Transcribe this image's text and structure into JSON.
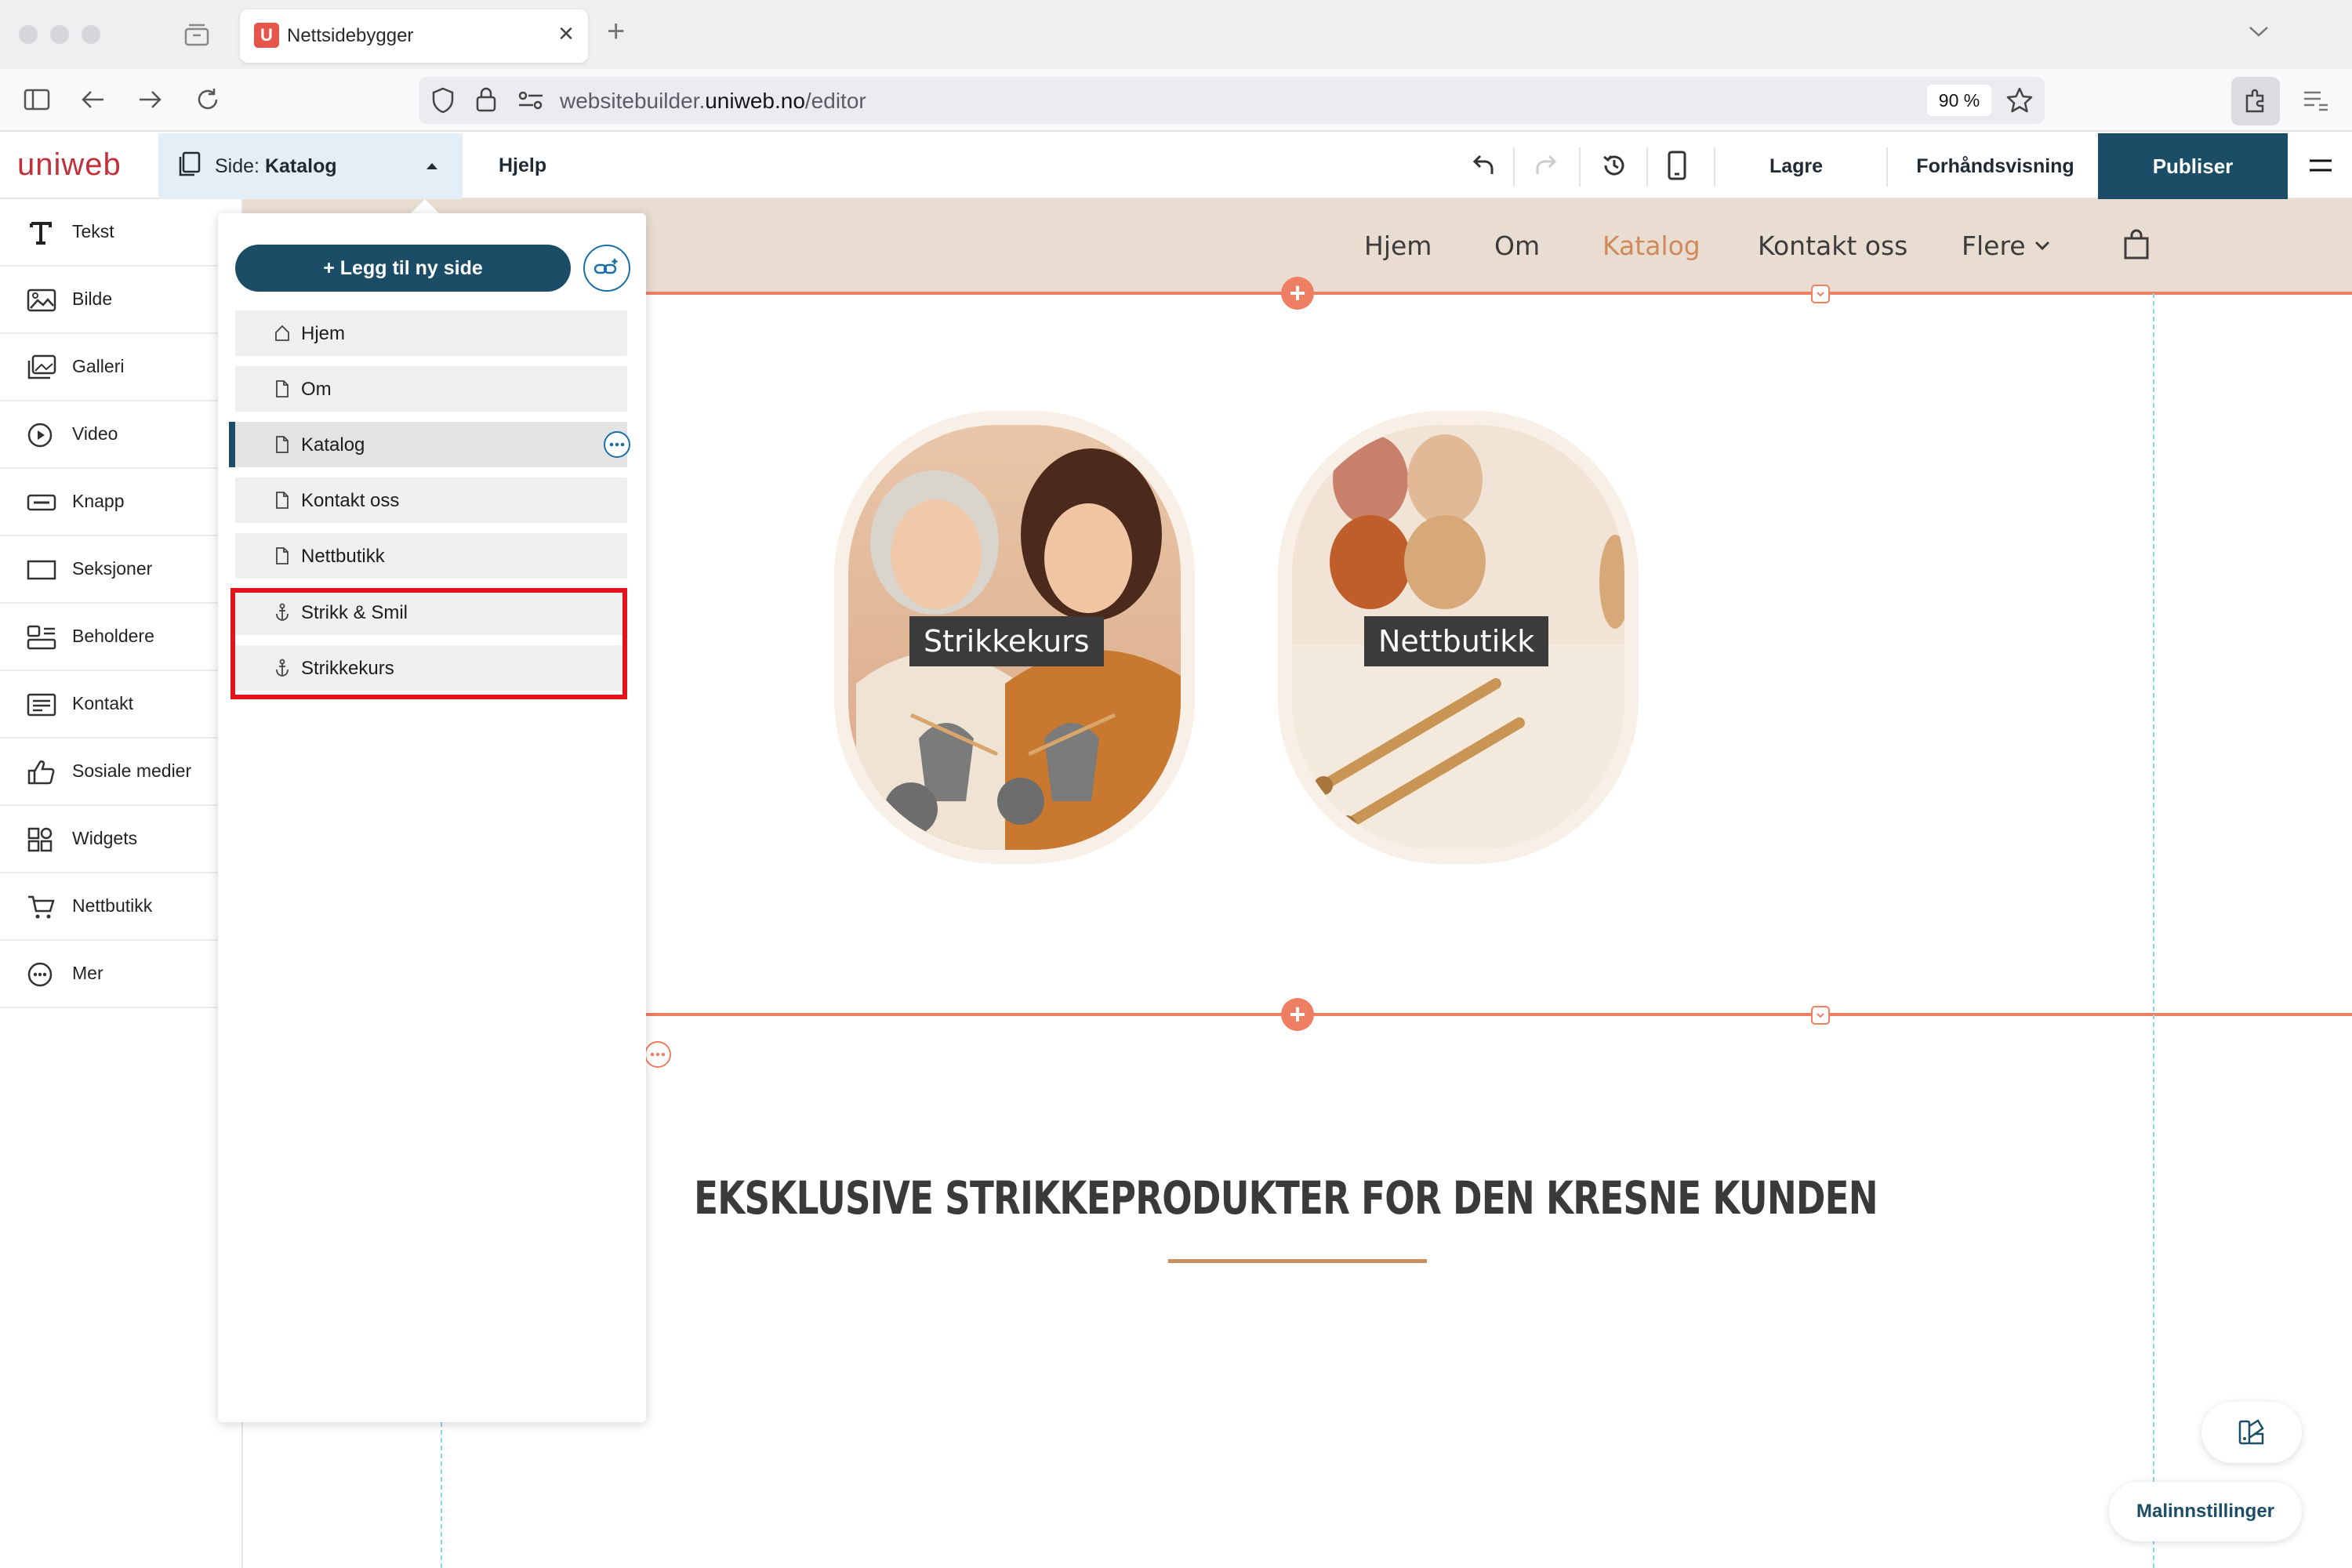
{
  "browser": {
    "tab_title": "Nettsidebygger",
    "tab_favicon_letter": "U",
    "url_host_prefix": "websitebuilder.",
    "url_host_main": "uniweb.no",
    "url_path": "/editor",
    "zoom": "90 %"
  },
  "app": {
    "logo": "uniweb",
    "page_selector_prefix": "Side: ",
    "page_selector_value": "Katalog",
    "help": "Hjelp",
    "save": "Lagre",
    "preview": "Forhåndsvisning",
    "publish": "Publiser",
    "accent_color": "#1b4e66",
    "brand_color": "#c3303a"
  },
  "tools": [
    {
      "label": "Tekst",
      "icon": "text-icon"
    },
    {
      "label": "Bilde",
      "icon": "image-icon"
    },
    {
      "label": "Galleri",
      "icon": "gallery-icon"
    },
    {
      "label": "Video",
      "icon": "play-icon"
    },
    {
      "label": "Knapp",
      "icon": "button-icon"
    },
    {
      "label": "Seksjoner",
      "icon": "section-icon"
    },
    {
      "label": "Beholdere",
      "icon": "container-icon"
    },
    {
      "label": "Kontakt",
      "icon": "contact-form-icon"
    },
    {
      "label": "Sosiale medier",
      "icon": "thumbs-up-icon"
    },
    {
      "label": "Widgets",
      "icon": "widgets-icon"
    },
    {
      "label": "Nettbutikk",
      "icon": "cart-icon"
    },
    {
      "label": "Mer",
      "icon": "more-icon"
    }
  ],
  "pages_panel": {
    "add_page": "+ Legg til ny side",
    "pages": [
      {
        "label": "Hjem",
        "icon": "home-icon"
      },
      {
        "label": "Om",
        "icon": "page-icon"
      },
      {
        "label": "Katalog",
        "icon": "page-icon",
        "active": true
      },
      {
        "label": "Kontakt oss",
        "icon": "page-icon"
      },
      {
        "label": "Nettbutikk",
        "icon": "page-icon"
      },
      {
        "label": "Strikk & Smil",
        "icon": "anchor-icon"
      },
      {
        "label": "Strikkekurs",
        "icon": "anchor-icon"
      }
    ]
  },
  "site": {
    "nav": [
      "Hjem",
      "Om",
      "Katalog",
      "Kontakt oss",
      "Flere"
    ],
    "nav_active": "Katalog",
    "active_color": "#d0895a",
    "cards": [
      {
        "label": "Strikkekurs"
      },
      {
        "label": "Nettbutikk"
      }
    ],
    "headline": "EKSKLUSIVE STRIKKEPRODUKTER FOR DEN KRESNE KUNDEN"
  },
  "floating": {
    "template_settings": "Malinnstillinger"
  }
}
